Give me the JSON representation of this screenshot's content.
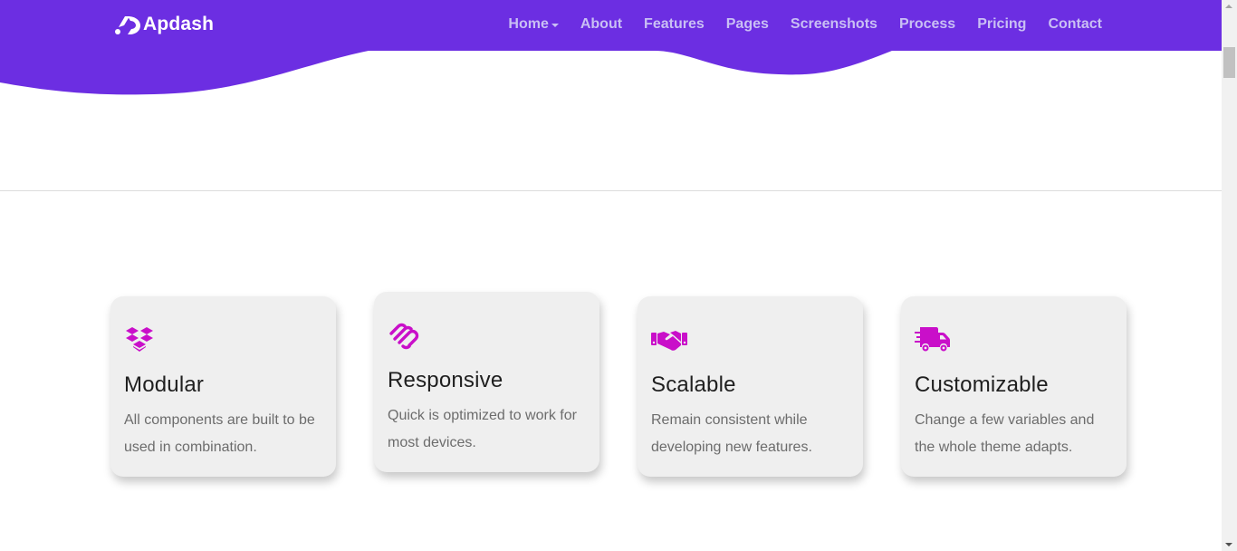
{
  "brand": {
    "name": "Apdash",
    "accent": "#6c2ee2"
  },
  "nav": {
    "items": [
      {
        "label": "Home",
        "has_dropdown": true
      },
      {
        "label": "About"
      },
      {
        "label": "Features"
      },
      {
        "label": "Pages"
      },
      {
        "label": "Screenshots"
      },
      {
        "label": "Process"
      },
      {
        "label": "Pricing"
      },
      {
        "label": "Contact"
      }
    ]
  },
  "features": [
    {
      "icon": "dropbox-icon",
      "title": "Modular",
      "text": "All components are built to be used in combination."
    },
    {
      "icon": "squarespace-icon",
      "title": "Responsive",
      "text": "Quick is optimized to work for most devices."
    },
    {
      "icon": "handshake-icon",
      "title": "Scalable",
      "text": "Remain consistent while developing new features."
    },
    {
      "icon": "shipping-fast-icon",
      "title": "Customizable",
      "text": "Change a few variables and the whole theme adapts."
    }
  ],
  "colors": {
    "icon": "#c90fc9",
    "nav_text": "#c9bff4",
    "card_bg": "#efefef"
  }
}
